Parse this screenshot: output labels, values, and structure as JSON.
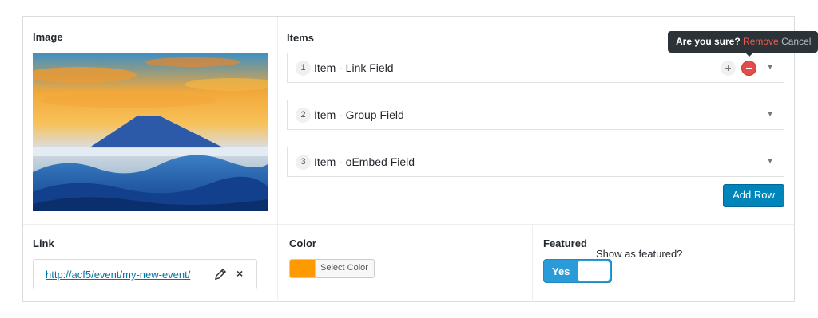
{
  "fields": {
    "image_label": "Image",
    "items_label": "Items",
    "link_label": "Link",
    "color_label": "Color",
    "featured_label": "Featured"
  },
  "repeater": {
    "rows": [
      {
        "index": "1",
        "title": "Item - Link Field"
      },
      {
        "index": "2",
        "title": "Item - Group Field"
      },
      {
        "index": "3",
        "title": "Item - oEmbed Field"
      }
    ],
    "add_symbol": "+",
    "caret": "▼",
    "add_row_label": "Add Row"
  },
  "tooltip": {
    "question": "Are you sure?",
    "remove": "Remove",
    "cancel": "Cancel"
  },
  "link": {
    "url": "http://acf5/event/my-new-event/",
    "icons": [
      "pencil-icon",
      "close-icon"
    ],
    "close_glyph": "×"
  },
  "color": {
    "value": "#ff9900",
    "button_label": "Select Color"
  },
  "featured": {
    "toggle_label": "Yes",
    "toggle_on": true,
    "description": "Show as featured?"
  },
  "colors": {
    "accent": "#0085ba",
    "remove_red": "#e24c4c",
    "toggle_blue": "#2a9bd8"
  }
}
